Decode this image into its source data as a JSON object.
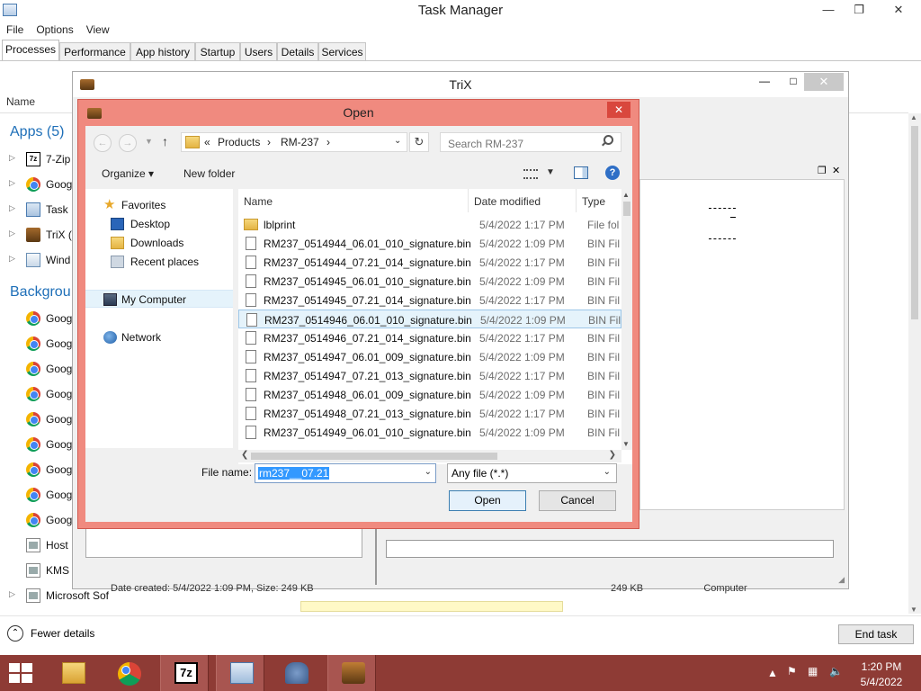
{
  "taskmgr": {
    "title": "Task Manager",
    "menu": [
      "File",
      "Options",
      "View"
    ],
    "tabs": [
      "Processes",
      "Performance",
      "App history",
      "Startup",
      "Users",
      "Details",
      "Services"
    ],
    "col_name": "Name",
    "apps_header": "Apps (5)",
    "apps": [
      "7-Zip",
      "Goog",
      "Task",
      "TriX (",
      "Wind"
    ],
    "background_header": "Backgrou",
    "background": [
      "Goog",
      "Goog",
      "Goog",
      "Goog",
      "Goog",
      "Goog",
      "Goog",
      "Goog",
      "Goog",
      "Host",
      "KMS",
      "Microsoft Sof"
    ],
    "fewer_details": "Fewer details",
    "end_task": "End task"
  },
  "trix": {
    "title": "TriX",
    "status_left": "Date created: 5/4/2022 1:09 PM, Size: 249 KB",
    "status_right": "249 KB",
    "status_right2": "Computer"
  },
  "dialog": {
    "title": "Open",
    "breadcrumb": [
      "«",
      "Products",
      "›",
      "RM-237",
      "›"
    ],
    "search_placeholder": "Search RM-237",
    "organize": "Organize ▾",
    "new_folder": "New folder",
    "nav": {
      "favorites": "Favorites",
      "desktop": "Desktop",
      "downloads": "Downloads",
      "recent": "Recent places",
      "computer": "My Computer",
      "network": "Network"
    },
    "columns": {
      "name": "Name",
      "date": "Date modified",
      "type": "Type"
    },
    "files": [
      {
        "name": "lblprint",
        "date": "5/4/2022 1:17 PM",
        "type": "File fol",
        "kind": "folder"
      },
      {
        "name": "RM237_0514944_06.01_010_signature.bin",
        "date": "5/4/2022 1:09 PM",
        "type": "BIN Fil",
        "kind": "file"
      },
      {
        "name": "RM237_0514944_07.21_014_signature.bin",
        "date": "5/4/2022 1:17 PM",
        "type": "BIN Fil",
        "kind": "file"
      },
      {
        "name": "RM237_0514945_06.01_010_signature.bin",
        "date": "5/4/2022 1:09 PM",
        "type": "BIN Fil",
        "kind": "file"
      },
      {
        "name": "RM237_0514945_07.21_014_signature.bin",
        "date": "5/4/2022 1:17 PM",
        "type": "BIN Fil",
        "kind": "file"
      },
      {
        "name": "RM237_0514946_06.01_010_signature.bin",
        "date": "5/4/2022 1:09 PM",
        "type": "BIN Fil",
        "kind": "file",
        "selected": true
      },
      {
        "name": "RM237_0514946_07.21_014_signature.bin",
        "date": "5/4/2022 1:17 PM",
        "type": "BIN Fil",
        "kind": "file"
      },
      {
        "name": "RM237_0514947_06.01_009_signature.bin",
        "date": "5/4/2022 1:09 PM",
        "type": "BIN Fil",
        "kind": "file"
      },
      {
        "name": "RM237_0514947_07.21_013_signature.bin",
        "date": "5/4/2022 1:17 PM",
        "type": "BIN Fil",
        "kind": "file"
      },
      {
        "name": "RM237_0514948_06.01_009_signature.bin",
        "date": "5/4/2022 1:09 PM",
        "type": "BIN Fil",
        "kind": "file"
      },
      {
        "name": "RM237_0514948_07.21_013_signature.bin",
        "date": "5/4/2022 1:17 PM",
        "type": "BIN Fil",
        "kind": "file"
      },
      {
        "name": "RM237_0514949_06.01_010_signature.bin",
        "date": "5/4/2022 1:09 PM",
        "type": "BIN Fil",
        "kind": "file"
      }
    ],
    "file_name_label": "File name:",
    "file_name_value": "rm237__07.21",
    "file_type": "Any file (*.*)",
    "open_button": "Open",
    "cancel_button": "Cancel"
  },
  "taskbar": {
    "time": "1:20 PM",
    "date": "5/4/2022",
    "accent": "#8e3b35"
  }
}
